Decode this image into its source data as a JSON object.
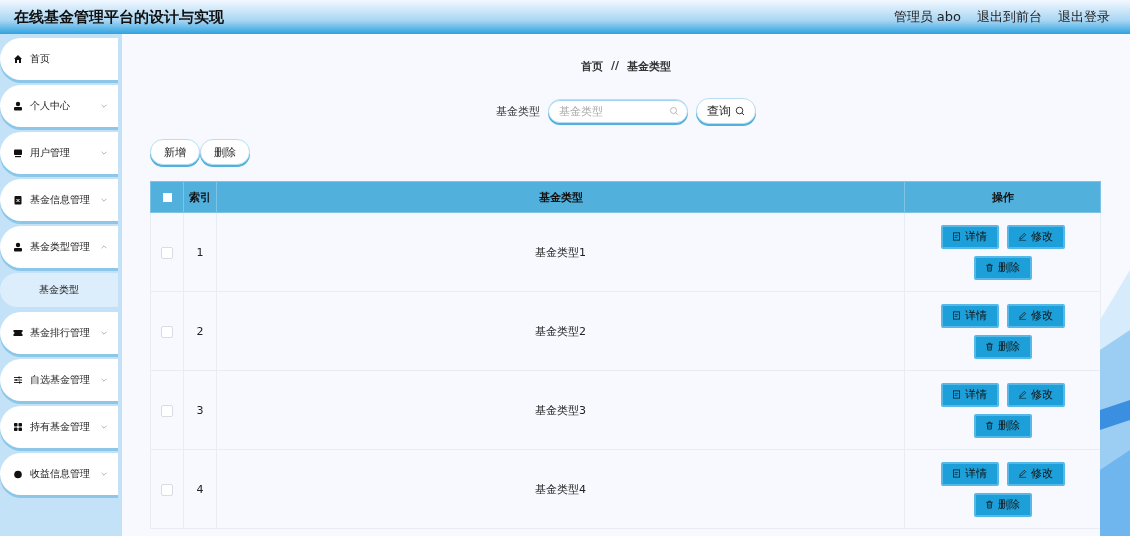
{
  "header": {
    "title": "在线基金管理平台的设计与实现",
    "user": "管理员 abo",
    "links": [
      "退出到前台",
      "退出登录"
    ]
  },
  "sidebar": {
    "items": [
      {
        "label": "首页",
        "has_arrow": false
      },
      {
        "label": "个人中心",
        "has_arrow": true,
        "expanded": false
      },
      {
        "label": "用户管理",
        "has_arrow": true,
        "expanded": false
      },
      {
        "label": "基金信息管理",
        "has_arrow": true,
        "expanded": false
      },
      {
        "label": "基金类型管理",
        "has_arrow": true,
        "expanded": true,
        "children": [
          {
            "label": "基金类型",
            "selected": true
          }
        ]
      },
      {
        "label": "基金排行管理",
        "has_arrow": true,
        "expanded": false
      },
      {
        "label": "自选基金管理",
        "has_arrow": true,
        "expanded": false
      },
      {
        "label": "持有基金管理",
        "has_arrow": true,
        "expanded": false
      },
      {
        "label": "收益信息管理",
        "has_arrow": true,
        "expanded": false
      }
    ]
  },
  "breadcrumb": {
    "items": [
      "首页",
      "基金类型"
    ],
    "separator": "//"
  },
  "search": {
    "label": "基金类型",
    "placeholder": "基金类型",
    "button": "查询"
  },
  "actions": [
    "新增",
    "删除"
  ],
  "table": {
    "all_checked": false,
    "columns": [
      "索引",
      "基金类型",
      "操作"
    ],
    "rows": [
      {
        "checked": false,
        "index": "1",
        "type": "基金类型1",
        "actions": [
          "详情",
          "修改",
          "删除"
        ]
      },
      {
        "checked": false,
        "index": "2",
        "type": "基金类型2",
        "actions": [
          "详情",
          "修改",
          "删除"
        ]
      },
      {
        "checked": false,
        "index": "3",
        "type": "基金类型3",
        "actions": [
          "详情",
          "修改",
          "删除"
        ]
      },
      {
        "checked": false,
        "index": "4",
        "type": "基金类型4",
        "actions": [
          "详情",
          "修改",
          "删除"
        ]
      }
    ]
  }
}
